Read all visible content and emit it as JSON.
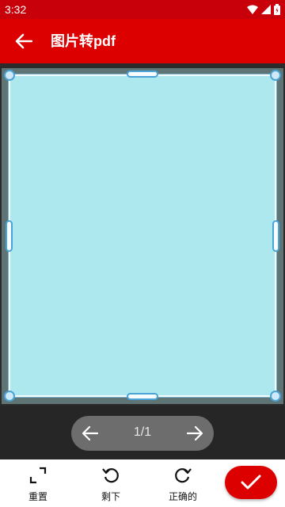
{
  "status_bar": {
    "time": "3:32",
    "icons": [
      "wifi-icon",
      "signal-icon",
      "battery-icon"
    ]
  },
  "app_bar": {
    "title": "图片转pdf",
    "back_icon": "arrow-left-icon",
    "color": "#dc0000"
  },
  "editor": {
    "crop_fill_color": "#ade8ef",
    "handle_color": "#4aa3d6"
  },
  "pager": {
    "count": "1/1",
    "prev_icon": "arrow-left-icon",
    "next_icon": "arrow-right-icon"
  },
  "toolbar": {
    "reset_label": "重置",
    "remaining_label": "剩下",
    "correct_label": "正确的",
    "confirm_icon": "checkmark-icon",
    "accent": "#dc0000"
  }
}
